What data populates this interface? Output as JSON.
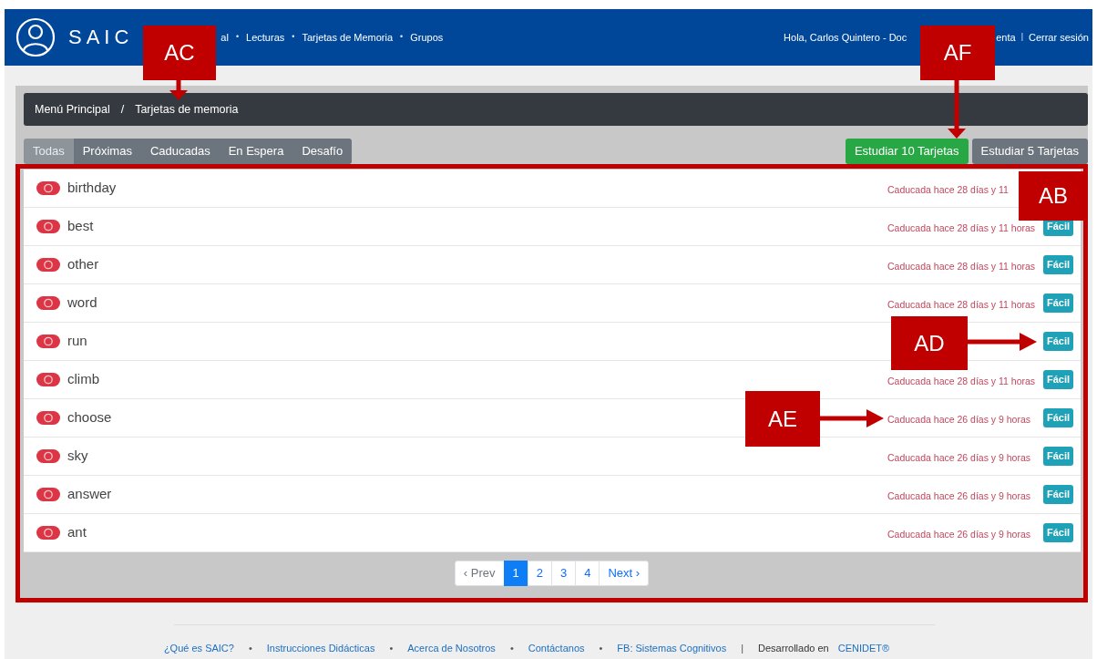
{
  "brand": "SAIC",
  "nav": [
    {
      "kind": "link",
      "label": "al"
    },
    {
      "kind": "separator",
      "label": "•"
    },
    {
      "kind": "link",
      "label": "Lecturas"
    },
    {
      "kind": "separator",
      "label": "•"
    },
    {
      "kind": "link",
      "label": "Tarjetas de Memoria"
    },
    {
      "kind": "separator",
      "label": "•"
    },
    {
      "kind": "link",
      "label": "Grupos"
    }
  ],
  "user": [
    {
      "kind": "link",
      "label": "Hola, Carlos Quintero - Doc"
    },
    {
      "kind": "gap-link",
      "label": "enta"
    },
    {
      "kind": "separator",
      "label": "|"
    },
    {
      "kind": "link",
      "label": "Cerrar sesión"
    }
  ],
  "breadcrumb": [
    {
      "kind": "link",
      "label": "Menú Principal"
    },
    {
      "kind": "separator",
      "label": "/"
    },
    {
      "kind": "current",
      "label": "Tarjetas de memoria"
    }
  ],
  "tabs": [
    {
      "label": "Todas",
      "selected": true
    },
    {
      "label": "Próximas",
      "selected": false
    },
    {
      "label": "Caducadas",
      "selected": false
    },
    {
      "label": "En Espera",
      "selected": false
    },
    {
      "label": "Desafío",
      "selected": false
    }
  ],
  "study_buttons": [
    {
      "label": "Estudiar 10 Tarjetas",
      "kind": "success"
    },
    {
      "label": "Estudiar 5 Tarjetas",
      "kind": "secondary"
    }
  ],
  "cards": [
    {
      "word": "birthday",
      "status": "Caducada hace 28 días y 11"
    },
    {
      "word": "best",
      "status": "Caducada hace 28 días y 11 horas",
      "badge": "Fácil"
    },
    {
      "word": "other",
      "status": "Caducada hace 28 días y 11 horas",
      "badge": "Fácil"
    },
    {
      "word": "word",
      "status": "Caducada hace 28 días y 11 horas",
      "badge": "Fácil"
    },
    {
      "word": "run",
      "badge": "Fácil"
    },
    {
      "word": "climb",
      "status": "Caducada hace 28 días y 11 horas",
      "badge": "Fácil"
    },
    {
      "word": "choose",
      "status": "Caducada hace 26 días y 9 horas",
      "badge": "Fácil"
    },
    {
      "word": "sky",
      "status": "Caducada hace 26 días y 9 horas",
      "badge": "Fácil"
    },
    {
      "word": "answer",
      "status": "Caducada hace 26 días y 9 horas",
      "badge": "Fácil"
    },
    {
      "word": "ant",
      "status": "Caducada hace 26 días y 9 horas",
      "badge": "Fácil"
    }
  ],
  "pagination": [
    {
      "label": "‹ Prev",
      "selected": false
    },
    {
      "label": "1",
      "selected": true
    },
    {
      "label": "2",
      "selected": false
    },
    {
      "label": "3",
      "selected": false
    },
    {
      "label": "4",
      "selected": false
    },
    {
      "label": "Next ›",
      "selected": false
    }
  ],
  "footer": [
    {
      "kind": "link",
      "label": "¿Qué es SAIC?"
    },
    {
      "kind": "separator",
      "label": "•"
    },
    {
      "kind": "link",
      "label": "Instrucciones Didácticas"
    },
    {
      "kind": "separator",
      "label": "•"
    },
    {
      "kind": "link",
      "label": "Acerca de Nosotros"
    },
    {
      "kind": "separator",
      "label": "•"
    },
    {
      "kind": "link",
      "label": "Contáctanos"
    },
    {
      "kind": "separator",
      "label": "•"
    },
    {
      "kind": "link",
      "label": "FB: Sistemas Cognitivos"
    },
    {
      "kind": "separator",
      "label": "|"
    },
    {
      "kind": "text",
      "label": "Desarrollado en"
    },
    {
      "kind": "link",
      "label": "CENIDET®"
    }
  ],
  "annotations": [
    {
      "label": "AC"
    },
    {
      "label": "AF"
    },
    {
      "label": "AB"
    },
    {
      "label": "AD"
    },
    {
      "label": "AE"
    }
  ]
}
